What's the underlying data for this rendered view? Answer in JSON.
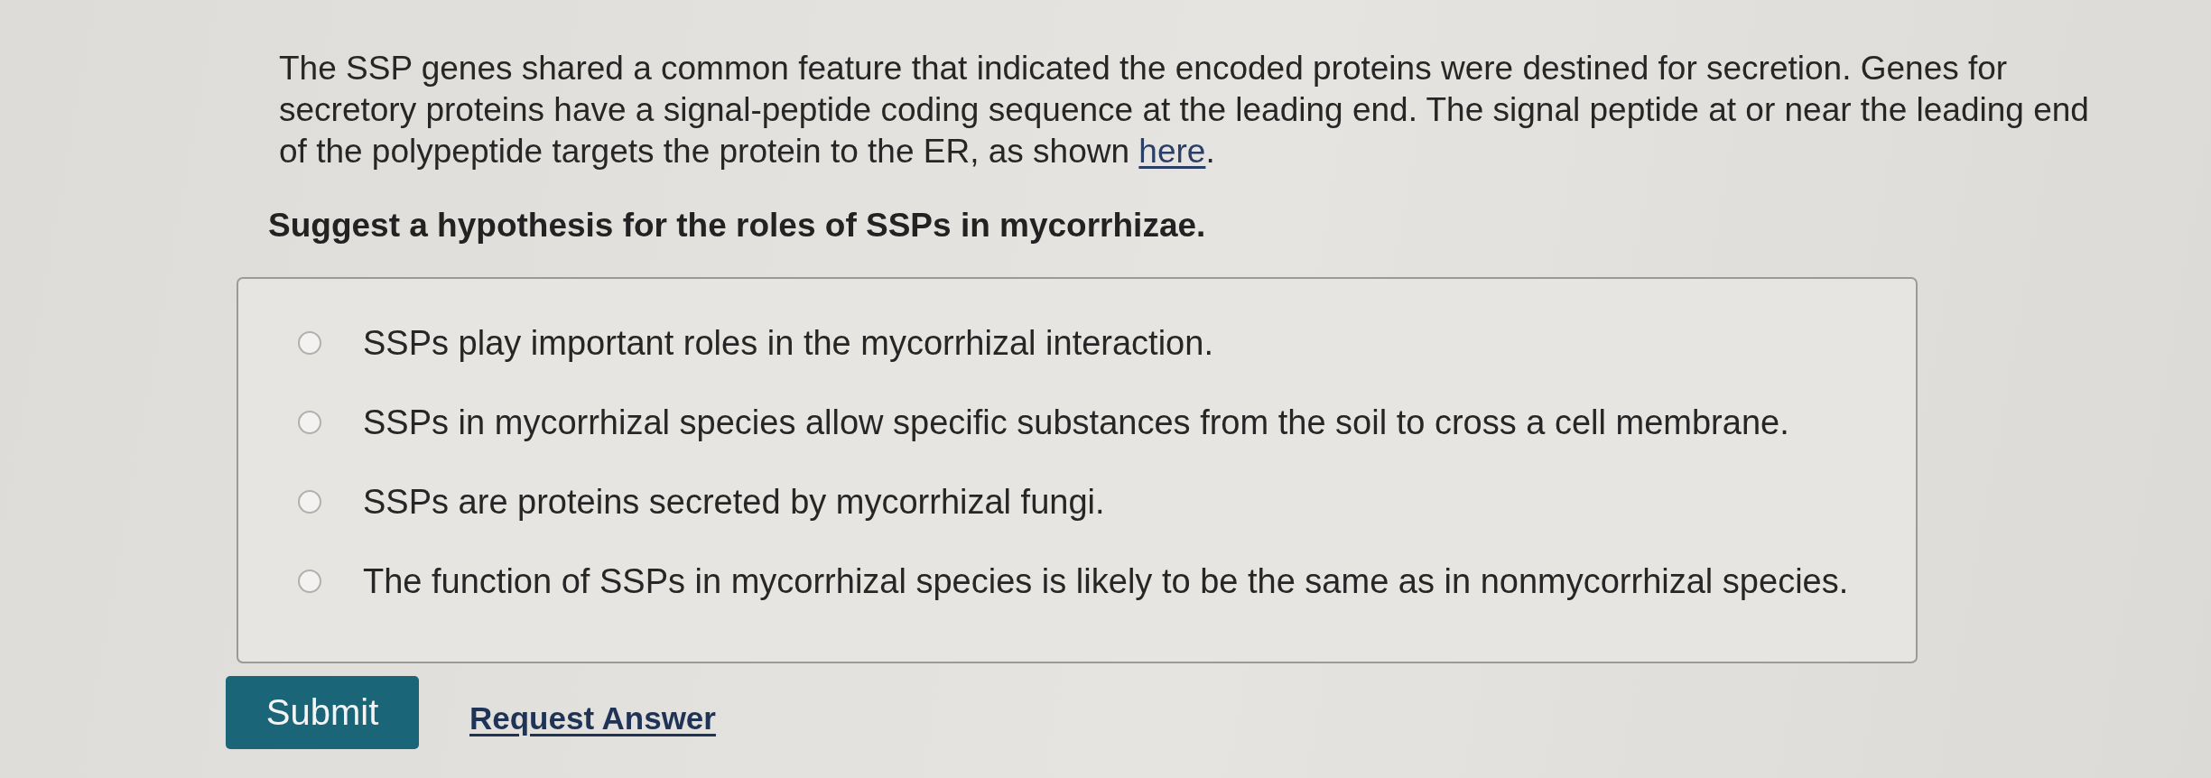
{
  "question": {
    "intro": [
      {
        "kind": "text",
        "text": "The SSP genes shared a common feature that indicated the encoded proteins were destined for secretion. Genes for secretory proteins have a signal-peptide coding sequence at the leading end. The signal peptide at or near the leading end of the polypeptide targets the protein to the ER, as shown "
      },
      {
        "kind": "link",
        "text": "here"
      },
      {
        "kind": "text",
        "text": "."
      }
    ],
    "prompt": "Suggest a hypothesis for the roles of SSPs in mycorrhizae."
  },
  "options": [
    {
      "label": "SSPs play important roles in the mycorrhizal interaction.",
      "selected": false
    },
    {
      "label": "SSPs in mycorrhizal species allow specific substances from the soil to cross a cell membrane.",
      "selected": false
    },
    {
      "label": "SSPs are proteins secreted by mycorrhizal fungi.",
      "selected": false
    },
    {
      "label": "The function of SSPs in mycorrhizal species is likely to be the same as in nonmycorrhizal species.",
      "selected": false
    }
  ],
  "actions": {
    "submit": "Submit",
    "request_answer": "Request Answer"
  }
}
